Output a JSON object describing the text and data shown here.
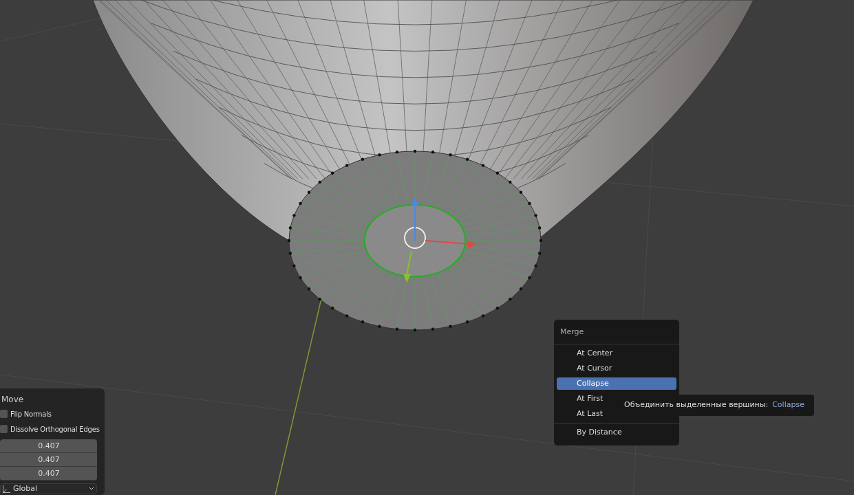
{
  "operator_panel": {
    "title": "Move",
    "options": [
      {
        "label": "Flip Normals",
        "checked": false
      },
      {
        "label": "Dissolve Orthogonal Edges",
        "checked": false
      }
    ],
    "values": [
      "0.407",
      "0.407",
      "0.407"
    ],
    "orientation": "Global"
  },
  "menu": {
    "title": "Merge",
    "sections": [
      {
        "items": [
          {
            "label": "At Center",
            "selected": false
          },
          {
            "label": "At Cursor",
            "selected": false
          },
          {
            "label": "Collapse",
            "selected": true
          },
          {
            "label": "At First",
            "selected": false
          },
          {
            "label": "At Last",
            "selected": false
          }
        ]
      },
      {
        "items": [
          {
            "label": "By Distance",
            "selected": false
          }
        ]
      }
    ]
  },
  "tooltip": {
    "text": "Объединить выделенные вершины:",
    "value": "Collapse"
  }
}
